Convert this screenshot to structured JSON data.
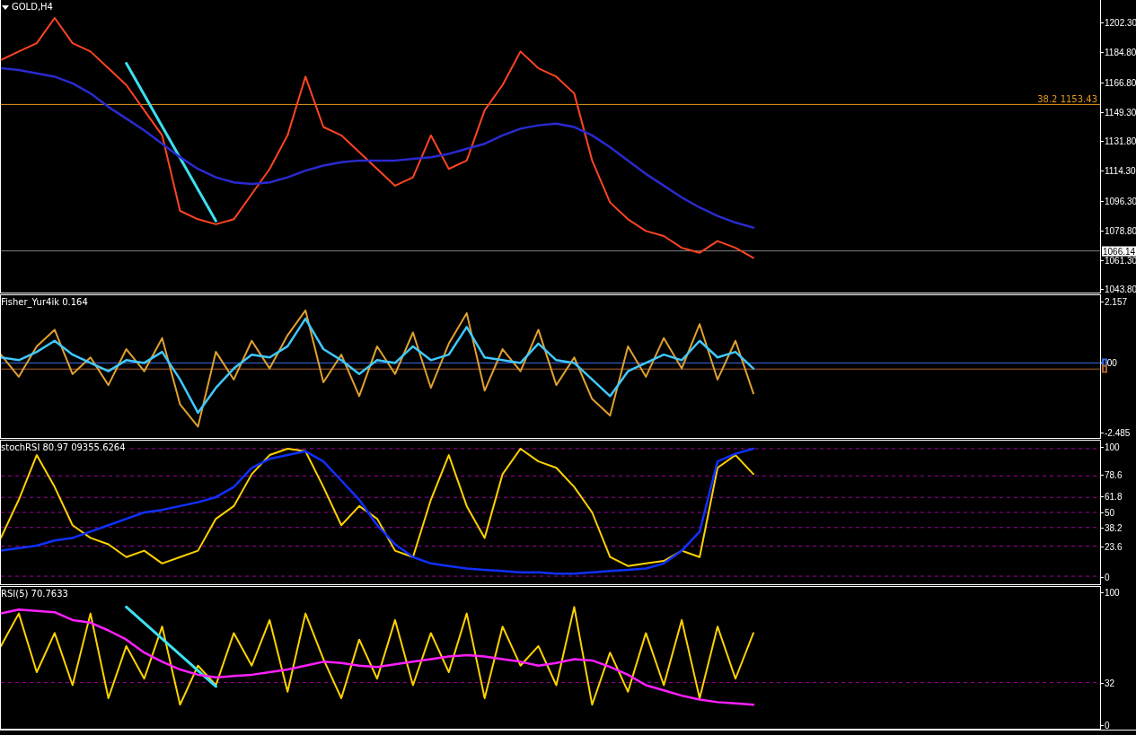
{
  "panes": [
    {
      "title": "GOLD,H4",
      "chart_data": {
        "type": "line",
        "ylim": [
          1041.3,
          1215.7
        ],
        "yticks": [
          {
            "value": 1202.3,
            "label": "1202.30"
          },
          {
            "value": 1184.8,
            "label": "1184.80"
          },
          {
            "value": 1166.8,
            "label": "1166.80"
          },
          {
            "value": 1149.3,
            "label": "1149.30"
          },
          {
            "value": 1131.8,
            "label": "1131.80"
          },
          {
            "value": 1114.3,
            "label": "1114.30"
          },
          {
            "value": 1096.3,
            "label": "1096.30"
          },
          {
            "value": 1078.8,
            "label": "1078.80"
          },
          {
            "value": 1061.3,
            "label": "1061.30"
          },
          {
            "value": 1043.8,
            "label": "1043.80"
          }
        ],
        "series": [
          {
            "color": "#ff4422",
            "values": [
              1180,
              1185,
              1190,
              1205,
              1190,
              1185,
              1175,
              1165,
              1150,
              1135,
              1090,
              1085,
              1082,
              1085,
              1100,
              1115,
              1135,
              1170,
              1140,
              1135,
              1125,
              1115,
              1105,
              1110,
              1135,
              1115,
              1120,
              1150,
              1165,
              1185,
              1175,
              1170,
              1160,
              1120,
              1095,
              1085,
              1078,
              1075,
              1068,
              1065,
              1072,
              1068,
              1062
            ]
          },
          {
            "color": "#3ce0f0",
            "values": [
              null,
              null,
              null,
              null,
              null,
              null,
              null,
              1178,
              null,
              null,
              null,
              null,
              1084
            ]
          },
          {
            "color": "#2a2ad0",
            "values": [
              1175,
              1174,
              1172,
              1170,
              1166,
              1160,
              1152,
              1145,
              1138,
              1130,
              1122,
              1115,
              1110,
              1107,
              1106,
              1107,
              1110,
              1114,
              1117,
              1119,
              1120,
              1120,
              1120,
              1121,
              1122,
              1124,
              1127,
              1130,
              1135,
              1139,
              1141,
              1142,
              1140,
              1135,
              1128,
              1120,
              1112,
              1105,
              1098,
              1092,
              1087,
              1083,
              1080
            ]
          }
        ],
        "ref_lines": [
          {
            "axis": "y",
            "value": 1153.43,
            "label": "38.2 1153.43",
            "color": "#e89a1c"
          },
          {
            "axis": "y",
            "value": 1066.14,
            "label": "1066.14",
            "color": "#808080"
          }
        ]
      }
    },
    {
      "title": "Fisher_Yur4ik 0.164",
      "chart_data": {
        "type": "line",
        "ylim": [
          -2.709,
          2.445
        ],
        "yticks": [
          {
            "value": 2.157,
            "label": "2.157"
          },
          {
            "value": 0,
            "label": ".00"
          },
          {
            "value": -2.485,
            "label": "-2.485"
          }
        ],
        "series": [
          {
            "color": "#e0a030",
            "values": [
              0.3,
              -0.5,
              0.6,
              1.2,
              -0.4,
              0.2,
              -0.8,
              0.5,
              -0.3,
              0.9,
              -1.5,
              -2.3,
              0.4,
              -0.6,
              0.8,
              -0.2,
              1.0,
              1.9,
              -0.7,
              0.3,
              -1.2,
              0.6,
              -0.4,
              1.1,
              -0.9,
              0.7,
              1.8,
              -1.0,
              0.5,
              -0.3,
              1.2,
              -0.8,
              0.2,
              -1.3,
              -1.9,
              0.6,
              -0.5,
              0.9,
              -0.2,
              1.4,
              -0.6,
              0.8,
              -1.1
            ]
          },
          {
            "color": "#40c8ff",
            "values": [
              0.2,
              0.1,
              0.4,
              0.8,
              0.3,
              0.0,
              -0.3,
              0.1,
              0.0,
              0.4,
              -0.6,
              -1.8,
              -0.9,
              -0.2,
              0.3,
              0.2,
              0.6,
              1.6,
              0.5,
              0.1,
              -0.4,
              0.1,
              0.0,
              0.6,
              0.1,
              0.3,
              1.3,
              0.2,
              0.1,
              0.0,
              0.7,
              0.1,
              0.0,
              -0.6,
              -1.2,
              -0.3,
              0.0,
              0.3,
              0.1,
              0.8,
              0.2,
              0.4,
              -0.2
            ]
          }
        ],
        "ref_lines": [
          {
            "axis": "y",
            "value": 0,
            "color": "#3a6ee8"
          },
          {
            "axis": "y",
            "value": -0.22,
            "color": "#b0602a"
          }
        ]
      }
    },
    {
      "title": "stochRSI 80.97",
      "title_extra": "09355.6264",
      "chart_data": {
        "type": "line",
        "ylim": [
          -6.3,
          106.3
        ],
        "yticks": [
          {
            "value": 100,
            "label": "100"
          },
          {
            "value": 78.6,
            "label": "78.6"
          },
          {
            "value": 61.8,
            "label": "61.8"
          },
          {
            "value": 50,
            "label": "50"
          },
          {
            "value": 38.2,
            "label": "38.2"
          },
          {
            "value": 23.6,
            "label": "23.6"
          },
          {
            "value": 0,
            "label": "0"
          }
        ],
        "series": [
          {
            "color": "#ffd200",
            "values": [
              30,
              60,
              95,
              70,
              40,
              30,
              25,
              15,
              20,
              10,
              15,
              20,
              45,
              55,
              80,
              95,
              100,
              98,
              70,
              40,
              55,
              45,
              20,
              15,
              60,
              95,
              55,
              30,
              80,
              100,
              90,
              85,
              70,
              50,
              15,
              8,
              10,
              12,
              20,
              15,
              85,
              95,
              80
            ]
          },
          {
            "color": "#1030ff",
            "values": [
              20,
              22,
              24,
              28,
              30,
              35,
              40,
              45,
              50,
              52,
              55,
              58,
              62,
              70,
              85,
              92,
              95,
              98,
              90,
              75,
              60,
              40,
              25,
              15,
              10,
              8,
              6,
              5,
              4,
              3,
              3,
              2,
              2,
              3,
              4,
              5,
              6,
              10,
              20,
              35,
              90,
              96,
              100
            ]
          }
        ],
        "grid": true
      }
    },
    {
      "title": "RSI(5) 70.7633",
      "chart_data": {
        "type": "line",
        "ylim": [
          -3.4,
          105.4
        ],
        "yticks": [
          {
            "value": 100,
            "label": "100"
          },
          {
            "value": 32,
            "label": "32"
          },
          {
            "value": 0,
            "label": "0"
          }
        ],
        "series": [
          {
            "color": "#ffd200",
            "values": [
              60,
              85,
              40,
              70,
              30,
              85,
              20,
              60,
              35,
              75,
              15,
              45,
              30,
              70,
              45,
              80,
              25,
              85,
              50,
              20,
              65,
              35,
              80,
              30,
              70,
              40,
              85,
              20,
              75,
              45,
              60,
              30,
              90,
              15,
              55,
              25,
              70,
              30,
              80,
              20,
              75,
              35,
              70
            ]
          },
          {
            "color": "#3ce0f0",
            "values": [
              null,
              null,
              null,
              null,
              null,
              null,
              null,
              90,
              null,
              null,
              null,
              null,
              29
            ]
          },
          {
            "color": "#ff20ff",
            "values": [
              85,
              88,
              87,
              86,
              80,
              78,
              72,
              65,
              55,
              48,
              42,
              38,
              36,
              37,
              38,
              40,
              42,
              45,
              48,
              47,
              45,
              44,
              46,
              48,
              50,
              52,
              53,
              52,
              50,
              48,
              45,
              47,
              50,
              49,
              44,
              38,
              30,
              26,
              22,
              19,
              17,
              16,
              15
            ]
          }
        ],
        "ref_lines": [
          {
            "axis": "y",
            "value": 32,
            "color": "#a000a0"
          }
        ]
      }
    }
  ]
}
